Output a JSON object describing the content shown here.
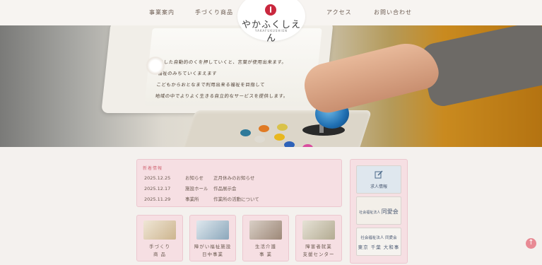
{
  "header": {
    "nav": [
      "事業案内",
      "手づくり商品",
      "アクセス",
      "お問い合わせ"
    ],
    "logo": {
      "title": "やかふくしえん",
      "subtitle": "YAKAFUKUSHIEN"
    }
  },
  "hero": {
    "screen_lines": [
      "あした自動的のくを押していくと、言葉が使用出来ます。",
      "福祉のみちていくまえます",
      "こどもからおとなまで利用出来る福祉を目指して",
      "地域の中でよりよく生きる自立的なサービスを提供します。"
    ]
  },
  "news": {
    "header": "新着情報",
    "items": [
      {
        "date": "2025.12.25",
        "category": "お知らせ",
        "title": "正月休みのお知らせ"
      },
      {
        "date": "2025.12.17",
        "category": "施設ホール",
        "title": "作品展示会"
      },
      {
        "date": "2025.11.29",
        "category": "事業所",
        "title": "作業所の活動について"
      }
    ]
  },
  "tiles": [
    {
      "line1": "手づくり",
      "line2": "商 品",
      "color": "#d8c7a8"
    },
    {
      "line1": "障がい福祉施設",
      "line2": "日中事業",
      "color": "#9fb7c9"
    },
    {
      "line1": "生活介護",
      "line2": "事 業",
      "color": "#b7a79a"
    },
    {
      "line1": "障害者就業",
      "line2": "支援センター",
      "color": "#c9c4b0"
    }
  ],
  "sidebar": {
    "recruit_label": "求人情報",
    "org_small": "社会福祉法人",
    "org_name": "同愛会",
    "council_line1": "社会福祉法人 同愛会",
    "council_line2": "東京 千葉 大和事"
  },
  "colors": {
    "accent_pink": "#f6dfe3",
    "logo_red": "#c9283e",
    "back_top": "#e88a94"
  }
}
